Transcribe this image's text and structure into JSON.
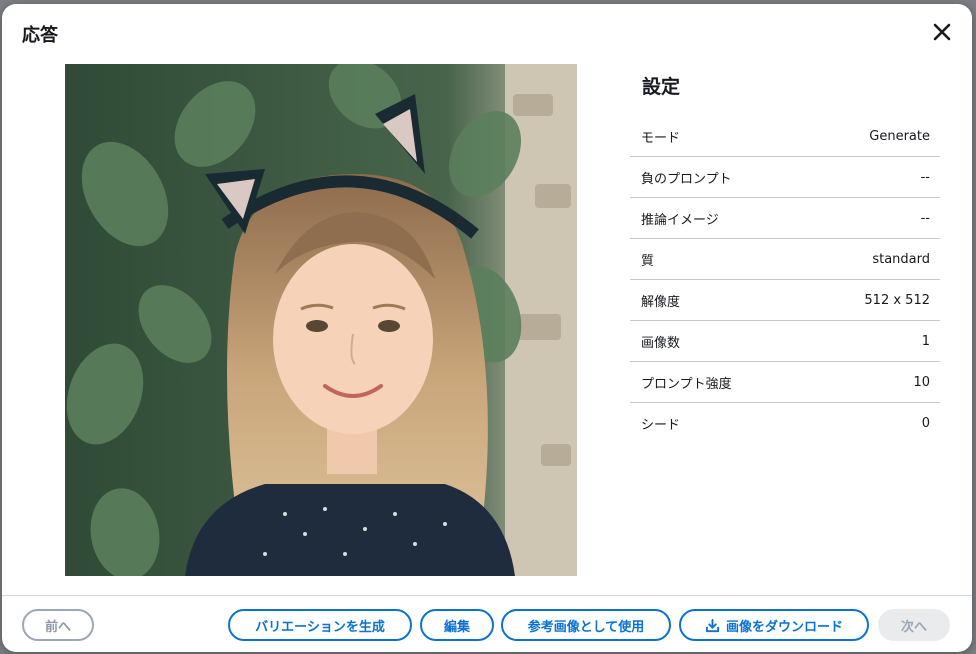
{
  "modal": {
    "title": "応答"
  },
  "settings": {
    "title": "設定",
    "rows": [
      {
        "label": "モード",
        "value": "Generate"
      },
      {
        "label": "負のプロンプト",
        "value": "--"
      },
      {
        "label": "推論イメージ",
        "value": "--"
      },
      {
        "label": "質",
        "value": "standard"
      },
      {
        "label": "解像度",
        "value": "512 x 512"
      },
      {
        "label": "画像数",
        "value": "1"
      },
      {
        "label": "プロンプト強度",
        "value": "10"
      },
      {
        "label": "シード",
        "value": "0"
      }
    ]
  },
  "footer": {
    "prev_label": "前へ",
    "variation_label": "バリエーションを生成",
    "edit_label": "編集",
    "reference_label": "参考画像として使用",
    "download_label": "画像をダウンロード",
    "next_label": "次へ"
  },
  "icons": {
    "close": "close-icon",
    "download": "download-icon"
  },
  "colors": {
    "accent": "#0972d3",
    "text": "#16191f",
    "disabled": "#9ba7b6",
    "divider": "#c6c9cc"
  }
}
